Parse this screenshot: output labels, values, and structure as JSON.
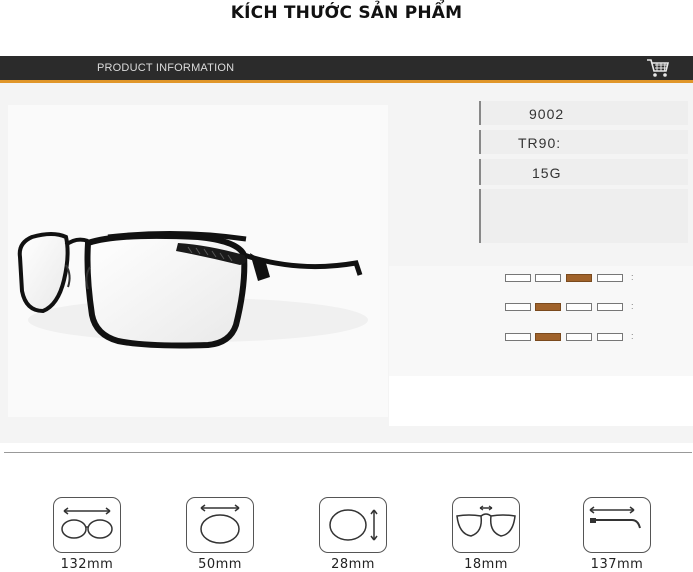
{
  "page": {
    "title": "KÍCH THƯỚC SẢN PHẨM"
  },
  "header": {
    "label": "PRODUCT INFORMATION",
    "cart_icon": "shopping-cart-icon",
    "accent": "#e0962a",
    "bar_color": "#2b2b2b"
  },
  "specs": [
    {
      "value": "9002"
    },
    {
      "value": "TR90:"
    },
    {
      "value": "15G"
    },
    {
      "value": ""
    }
  ],
  "levels": [
    {
      "active": 3,
      "tail": ":"
    },
    {
      "active": 2,
      "tail": ":"
    },
    {
      "active": 2,
      "tail": ":"
    }
  ],
  "level_colors": {
    "active": "#a0622a"
  },
  "dimensions": [
    {
      "icon": "total-width-icon",
      "label": "132mm"
    },
    {
      "icon": "lens-width-icon",
      "label": "50mm"
    },
    {
      "icon": "lens-height-icon",
      "label": "28mm"
    },
    {
      "icon": "bridge-width-icon",
      "label": "18mm"
    },
    {
      "icon": "temple-length-icon",
      "label": "137mm"
    }
  ]
}
